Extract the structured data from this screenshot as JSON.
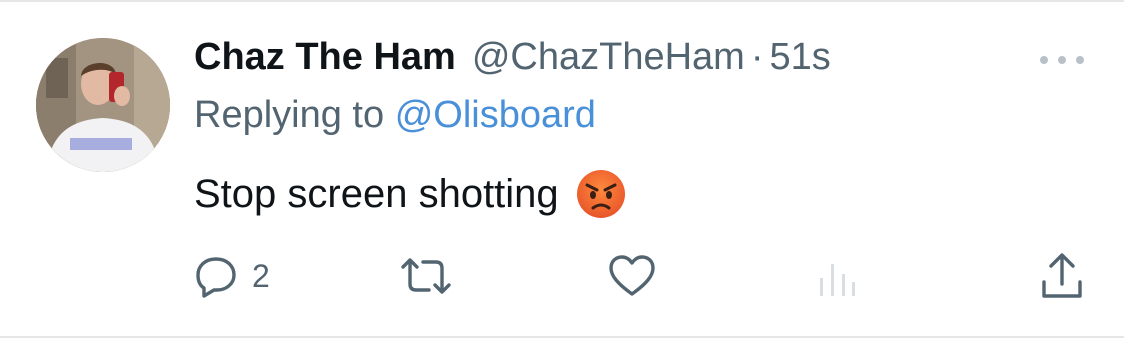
{
  "tweet": {
    "display_name": "Chaz The Ham",
    "handle": "@ChazTheHam",
    "separator": "·",
    "time": "51s",
    "replying_prefix": "Replying to",
    "replying_handle": "@Olisboard",
    "text": "Stop screen shotting",
    "emoji": "angry-face-emoji"
  },
  "actions": {
    "reply_count": "2",
    "reply_icon": "reply-icon",
    "retweet_icon": "retweet-icon",
    "like_icon": "heart-icon",
    "views_icon": "analytics-icon",
    "share_icon": "share-icon"
  },
  "colors": {
    "text_primary": "#0f1419",
    "text_secondary": "#536471",
    "link": "#4a90d9",
    "icon": "#536471",
    "icon_disabled": "#d9dee2"
  }
}
